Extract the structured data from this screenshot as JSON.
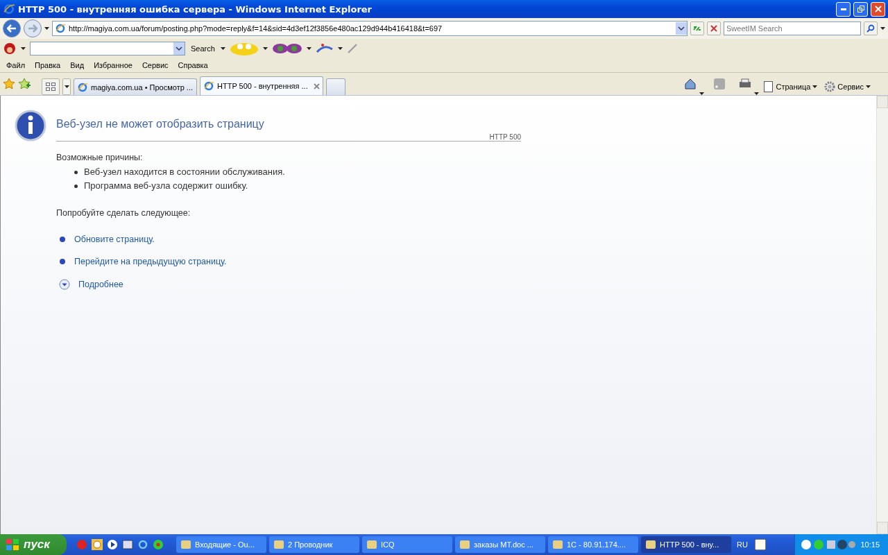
{
  "window": {
    "title": "HTTP 500 - внутренняя ошибка сервера - Windows Internet Explorer"
  },
  "address": {
    "value": "http://magiya.com.ua/forum/posting.php?mode=reply&f=14&sid=4d3ef12f3856e480ac129d944b416418&t=697"
  },
  "search": {
    "placeholder": "SweetIM Search"
  },
  "toolbar": {
    "search_label": "Search"
  },
  "menu": [
    "Файл",
    "Правка",
    "Вид",
    "Избранное",
    "Сервис",
    "Справка"
  ],
  "tabs": [
    {
      "label": "magiya.com.ua • Просмотр ...",
      "selected": false
    },
    {
      "label": "HTTP 500 - внутренняя ...",
      "selected": true
    }
  ],
  "command_bar": [
    "Страница",
    "Сервис"
  ],
  "page": {
    "title": "Веб-узел не может отобразить страницу",
    "code": "HTTP 500",
    "causes_heading": "Возможные причины:",
    "causes": [
      "Веб-узел находится в состоянии обслуживания.",
      "Программа веб-узла содержит ошибку."
    ],
    "try_heading": "Попробуйте сделать следующее:",
    "actions": [
      {
        "kind": "bullet",
        "label": "Обновите страницу."
      },
      {
        "kind": "bullet",
        "label": "Перейдите на предыдущую страницу."
      },
      {
        "kind": "expand",
        "label": "Подробнее"
      }
    ]
  },
  "taskbar": {
    "start": "пуск",
    "items": [
      {
        "label": "Входящие - Ou...",
        "selected": false
      },
      {
        "label": "2 Проводник",
        "selected": false
      },
      {
        "label": "ICQ",
        "selected": false
      },
      {
        "label": "заказы MT.doc ...",
        "selected": false
      },
      {
        "label": "1C - 80.91.174....",
        "selected": false
      },
      {
        "label": "HTTP 500 - вну...",
        "selected": true
      }
    ],
    "language": "RU",
    "clock": "10:15"
  }
}
